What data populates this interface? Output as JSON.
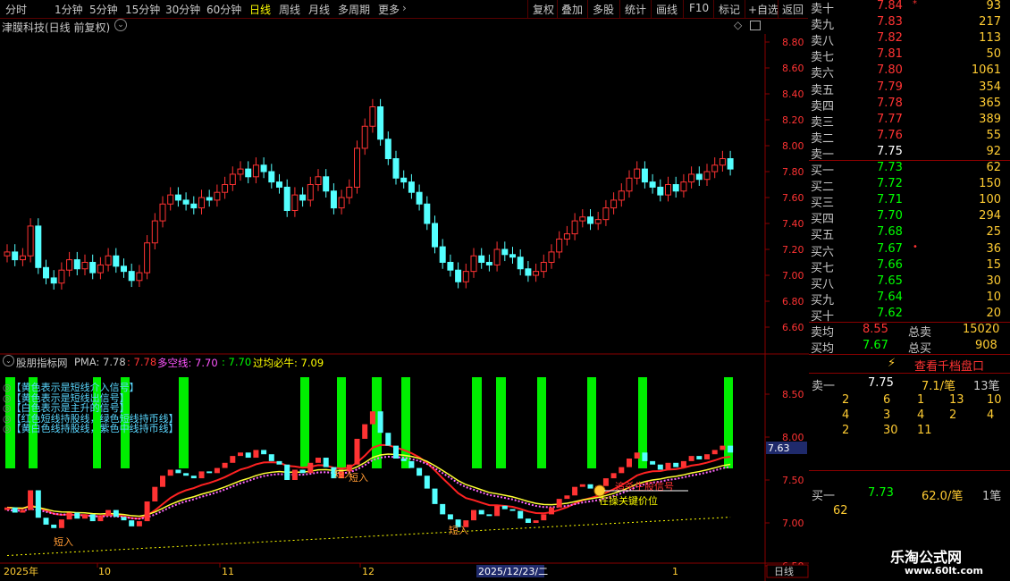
{
  "toolbar": {
    "left_items": [
      "分时",
      "1分钟",
      "5分钟",
      "15分钟",
      "30分钟",
      "60分钟",
      "日线",
      "周线",
      "月线",
      "多周期",
      "更多"
    ],
    "right_items": [
      "复权",
      "叠加",
      "多股",
      "统计",
      "画线",
      "F10",
      "标记",
      "+自选",
      "返回"
    ],
    "active_item": "日线"
  },
  "chart_title": "津膜科技(日线 前复权)",
  "price_axis": [
    "8.80",
    "8.60",
    "8.40",
    "8.20",
    "8.00",
    "7.80",
    "7.60",
    "7.40",
    "7.20",
    "7.00",
    "6.80",
    "6.60"
  ],
  "indicator_axis": [
    "8.50",
    "8.00",
    "7.50",
    "7.00",
    "6.50"
  ],
  "current_price_tag": "7.63",
  "indicator_legend": {
    "name": "股朋指标网",
    "pma_label": "PMA: 7.78",
    "value2": ": 7.78",
    "multi_label": "多空线: 7.70",
    "value4": ": 7.70",
    "bull_label": "过均必牛: 7.09"
  },
  "indicator_notes": [
    "【黄色表示是短线介入信号】",
    "【黄色表示是短线出信号】",
    "【白色表示是主升的信号】",
    "【红色短线持股线，绿色短线持币线】",
    "【黄白色线持股线，紫色中线持币线】"
  ],
  "annotations": {
    "short_in": "短入",
    "kill_signal": "追杀生股信号",
    "above_key": "在操关键价位"
  },
  "date_axis": [
    "2025年",
    "10",
    "11",
    "12",
    "2025/12/23/二",
    "1",
    "2"
  ],
  "date_axis_right": "日线",
  "order_book": {
    "asks": [
      {
        "label": "卖十",
        "price": "7.84",
        "vol": "93",
        "mark": "*"
      },
      {
        "label": "卖九",
        "price": "7.83",
        "vol": "217",
        "mark": ""
      },
      {
        "label": "卖八",
        "price": "7.82",
        "vol": "113",
        "mark": ""
      },
      {
        "label": "卖七",
        "price": "7.81",
        "vol": "50",
        "mark": ""
      },
      {
        "label": "卖六",
        "price": "7.80",
        "vol": "1061",
        "mark": ""
      },
      {
        "label": "卖五",
        "price": "7.79",
        "vol": "354",
        "mark": ""
      },
      {
        "label": "卖四",
        "price": "7.78",
        "vol": "365",
        "mark": ""
      },
      {
        "label": "卖三",
        "price": "7.77",
        "vol": "389",
        "mark": ""
      },
      {
        "label": "卖二",
        "price": "7.76",
        "vol": "55",
        "mark": ""
      },
      {
        "label": "卖一",
        "price": "7.75",
        "vol": "92",
        "mark": ""
      }
    ],
    "bids": [
      {
        "label": "买一",
        "price": "7.73",
        "vol": "62",
        "mark": ""
      },
      {
        "label": "买二",
        "price": "7.72",
        "vol": "150",
        "mark": ""
      },
      {
        "label": "买三",
        "price": "7.71",
        "vol": "100",
        "mark": ""
      },
      {
        "label": "买四",
        "price": "7.70",
        "vol": "294",
        "mark": ""
      },
      {
        "label": "买五",
        "price": "7.68",
        "vol": "25",
        "mark": ""
      },
      {
        "label": "买六",
        "price": "7.67",
        "vol": "36",
        "mark": "•"
      },
      {
        "label": "买七",
        "price": "7.66",
        "vol": "15",
        "mark": ""
      },
      {
        "label": "买八",
        "price": "7.65",
        "vol": "30",
        "mark": ""
      },
      {
        "label": "买九",
        "price": "7.64",
        "vol": "10",
        "mark": ""
      },
      {
        "label": "买十",
        "price": "7.62",
        "vol": "20",
        "mark": ""
      }
    ],
    "avg_sell_label": "卖均",
    "avg_sell_price": "8.55",
    "total_sell_label": "总卖",
    "total_sell": "15020",
    "avg_buy_label": "买均",
    "avg_buy_price": "7.67",
    "total_buy_label": "总买",
    "total_buy": "908"
  },
  "panel2": {
    "link": "查看千档盘口",
    "sell1_label": "卖一",
    "sell1_price": "7.75",
    "sell1_per": "7.1/笔",
    "sell1_count": "13笔",
    "sell_rows": [
      [
        "2",
        "6",
        "1",
        "13",
        "10"
      ],
      [
        "4",
        "3",
        "4",
        "2",
        "4"
      ],
      [
        "2",
        "30",
        "11",
        "",
        ""
      ]
    ],
    "buy1_label": "买一",
    "buy1_price": "7.73",
    "buy1_per": "62.0/笔",
    "buy1_count": "1笔",
    "buy_rows": [
      [
        "62"
      ]
    ]
  },
  "watermark": {
    "title": "乐淘公式网",
    "url": "www.60lt.com"
  },
  "colors": {
    "up": "#ff3333",
    "down": "#54ffff",
    "grid": "#8a0000",
    "green_bar": "#00ff00",
    "yellow": "#ffff00"
  }
}
